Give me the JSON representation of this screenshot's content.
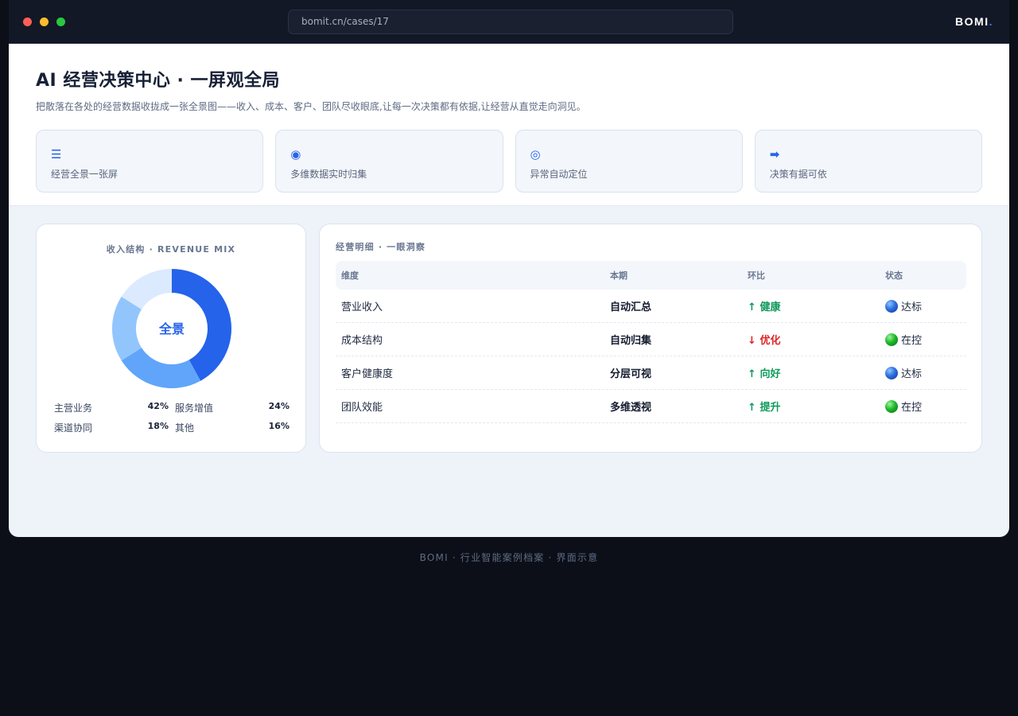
{
  "browser": {
    "url": "bomit.cn/cases/17",
    "brand": "BOMI",
    "brand_dot": "."
  },
  "hero": {
    "title": "AI 经营决策中心 · 一屏观全局",
    "subtitle": "把散落在各处的经营数据收拢成一张全景图——收入、成本、客户、团队尽收眼底,让每一次决策都有依据,让经营从直觉走向洞见。",
    "features": [
      {
        "icon": "list-icon",
        "glyph": "☰",
        "label": "经营全景一张屏"
      },
      {
        "icon": "dot-circle-icon",
        "glyph": "◉",
        "label": "多维数据实时归集"
      },
      {
        "icon": "target-icon",
        "glyph": "◎",
        "label": "异常自动定位"
      },
      {
        "icon": "arrow-right-icon",
        "glyph": "➡",
        "label": "决策有据可依"
      }
    ]
  },
  "revenue": {
    "title": "收入结构 · REVENUE MIX",
    "center_label": "全景",
    "legend": [
      {
        "label": "主营业务",
        "value": "42%"
      },
      {
        "label": "服务增值",
        "value": "24%"
      },
      {
        "label": "渠道协同",
        "value": "18%"
      },
      {
        "label": "其他",
        "value": "16%"
      }
    ]
  },
  "chart_data": {
    "type": "pie",
    "categories": [
      "主营业务",
      "服务增值",
      "渠道协同",
      "其他"
    ],
    "values": [
      42,
      24,
      18,
      16
    ],
    "colors": [
      "#2563eb",
      "#60a5fa",
      "#93c5fd",
      "#dbeafe"
    ]
  },
  "detail": {
    "title": "经营明细 · 一眼洞察",
    "headers": [
      "维度",
      "本期",
      "环比",
      "状态"
    ],
    "rows": [
      {
        "dimension": "营业收入",
        "period": "自动汇总",
        "trend_arrow": "↑",
        "trend": "健康",
        "trend_dir": "up",
        "status_color": "blue",
        "status": "达标"
      },
      {
        "dimension": "成本结构",
        "period": "自动归集",
        "trend_arrow": "↓",
        "trend": "优化",
        "trend_dir": "down",
        "status_color": "green",
        "status": "在控"
      },
      {
        "dimension": "客户健康度",
        "period": "分层可视",
        "trend_arrow": "↑",
        "trend": "向好",
        "trend_dir": "up",
        "status_color": "blue",
        "status": "达标"
      },
      {
        "dimension": "团队效能",
        "period": "多维透视",
        "trend_arrow": "↑",
        "trend": "提升",
        "trend_dir": "up",
        "status_color": "green",
        "status": "在控"
      }
    ]
  },
  "footer": "BOMI · 行业智能案例档案 · 界面示意"
}
